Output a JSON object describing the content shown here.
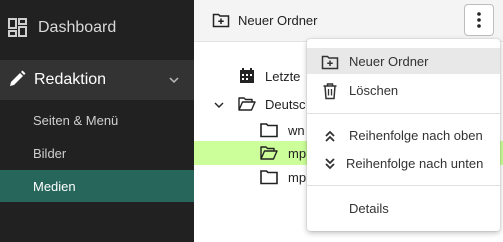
{
  "sidebar": {
    "dashboard_label": "Dashboard",
    "group_label": "Redaktion",
    "items": [
      {
        "label": "Seiten & Menü"
      },
      {
        "label": "Bilder"
      },
      {
        "label": "Medien"
      }
    ],
    "active_item": "Medien"
  },
  "toolbar": {
    "new_folder_label": "Neuer Ordner"
  },
  "tree": {
    "recent_label": "Letzte",
    "root_label": "Deutsc",
    "children": [
      {
        "label": "wn"
      },
      {
        "label": "mp"
      },
      {
        "label": "mp"
      }
    ]
  },
  "menu": {
    "items": [
      {
        "label": "Neuer Ordner",
        "icon": "folder-plus-icon"
      },
      {
        "label": "Löschen",
        "icon": "trash-icon"
      },
      {
        "label": "Reihenfolge nach oben",
        "icon": "double-chevron-up-icon"
      },
      {
        "label": "Reihenfolge nach unten",
        "icon": "double-chevron-down-icon"
      },
      {
        "label": "Details",
        "icon": ""
      }
    ]
  },
  "colors": {
    "sidebar_bg": "#212121",
    "group_bg": "#333333",
    "active_bg": "#26665b",
    "selected_row": "#ccff99"
  }
}
